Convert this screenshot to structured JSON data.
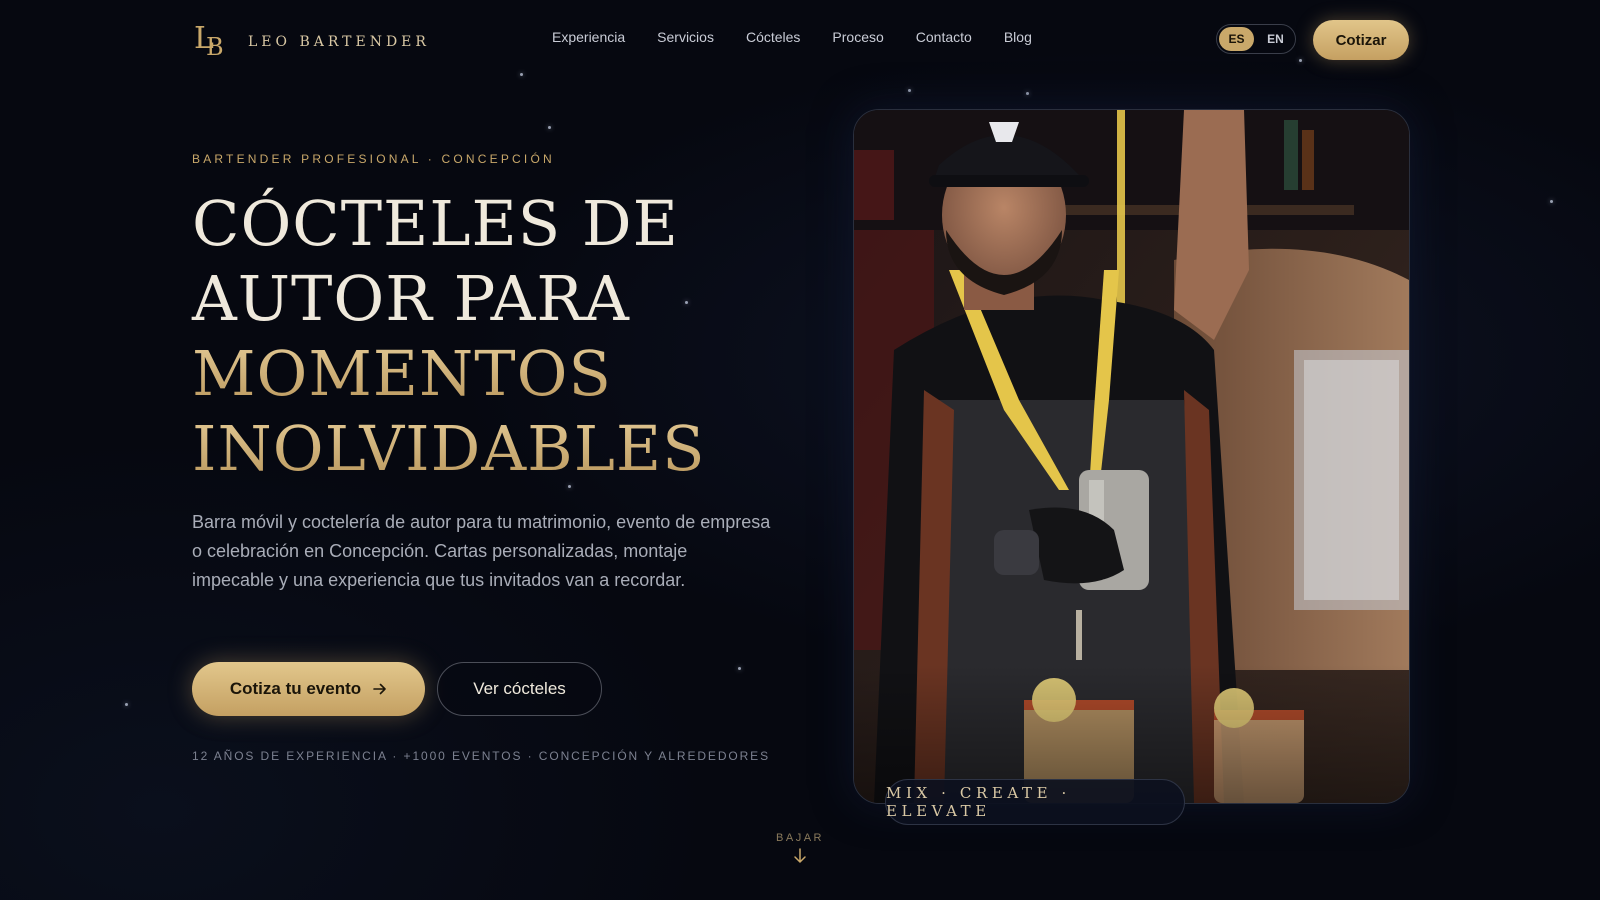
{
  "brand": {
    "monogram_1": "L",
    "monogram_2": "B",
    "name": "LEO BARTENDER"
  },
  "nav": {
    "items": [
      "Experiencia",
      "Servicios",
      "Cócteles",
      "Proceso",
      "Contacto",
      "Blog"
    ]
  },
  "language": {
    "options": [
      "ES",
      "EN"
    ],
    "selected": "ES"
  },
  "header_cta": "Cotizar",
  "hero": {
    "eyebrow": "BARTENDER PROFESIONAL · CONCEPCIÓN",
    "headline_lines": [
      "CÓCTELES DE",
      "AUTOR PARA"
    ],
    "headline_gold_lines": [
      "MOMENTOS",
      "INOLVIDABLES"
    ],
    "description": "Barra móvil y coctelería de autor para tu matrimonio, evento de empresa o celebración en Concepción. Cartas personalizadas, montaje impecable y una experiencia que tus invitados van a recordar.",
    "primary_cta": "Cotiza tu evento",
    "primary_cta_icon": "arrow-right-icon",
    "secondary_cta": "Ver cócteles",
    "stats": "12 AÑOS DE EXPERIENCIA · +1000 EVENTOS · CONCEPCIÓN Y ALREDEDORES"
  },
  "photo": {
    "subject": "bartender-pouring-cocktail",
    "tagline": "MIX · CREATE · ELEVATE"
  },
  "scroll_hint": {
    "label": "BAJAR",
    "icon": "arrow-down-icon"
  },
  "colors": {
    "background": "#060810",
    "gold": "#c9a86a",
    "gold_light": "#e2c78c",
    "text_light": "#efe9dc",
    "text_muted": "#a9adb8"
  }
}
